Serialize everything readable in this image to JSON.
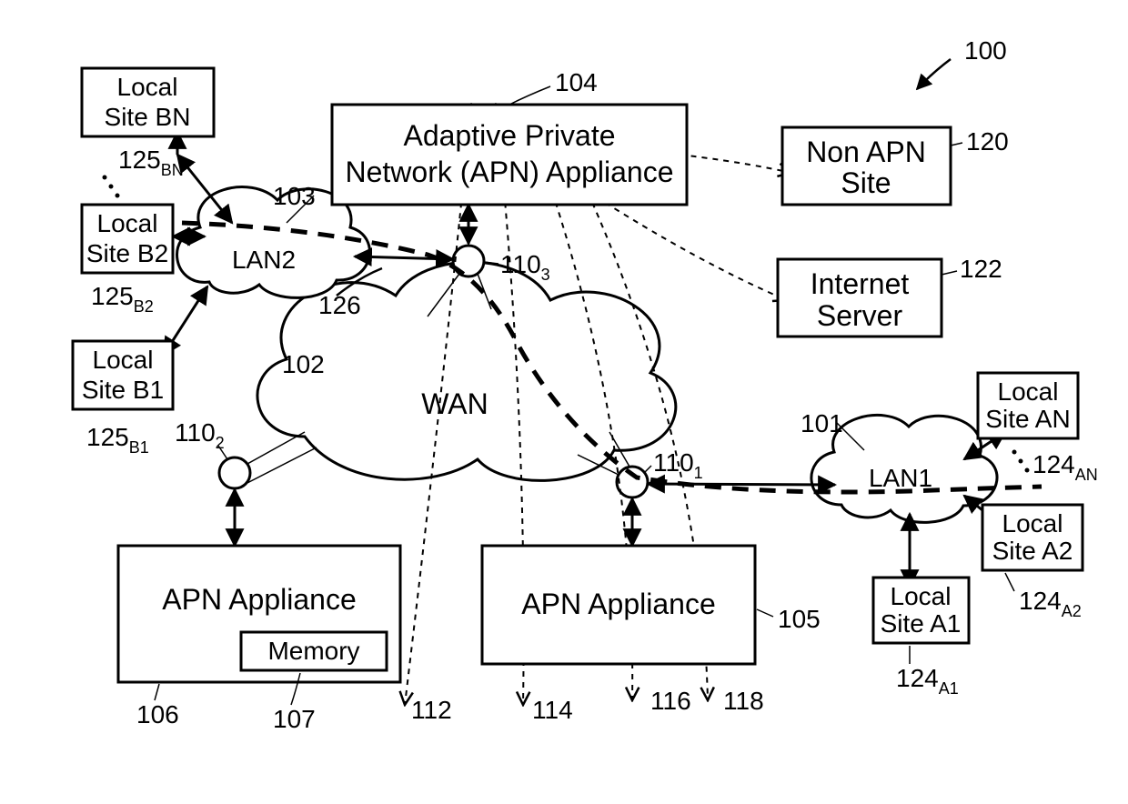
{
  "figure_ref": "100",
  "boxes": {
    "site_bn": {
      "label_l1": "Local",
      "label_l2": "Site BN",
      "ref": "125",
      "ref_sub": "BN"
    },
    "site_b2": {
      "label_l1": "Local",
      "label_l2": "Site B2",
      "ref": "125",
      "ref_sub": "B2"
    },
    "site_b1": {
      "label_l1": "Local",
      "label_l2": "Site B1",
      "ref": "125",
      "ref_sub": "B1"
    },
    "apn_main": {
      "label_l1": "Adaptive Private",
      "label_l2": "Network (APN) Appliance",
      "ref": "104"
    },
    "non_apn": {
      "label_l1": "Non APN",
      "label_l2": "Site",
      "ref": "120"
    },
    "inet": {
      "label_l1": "Internet",
      "label_l2": "Server",
      "ref": "122"
    },
    "site_an": {
      "label_l1": "Local",
      "label_l2": "Site AN",
      "ref": "124",
      "ref_sub": "AN"
    },
    "site_a2": {
      "label_l1": "Local",
      "label_l2": "Site A2",
      "ref": "124",
      "ref_sub": "A2"
    },
    "site_a1": {
      "label_l1": "Local",
      "label_l2": "Site A1",
      "ref": "124",
      "ref_sub": "A1"
    },
    "apn_left": {
      "label": "APN Appliance",
      "memory_label": "Memory",
      "ref": "106",
      "mem_ref": "107"
    },
    "apn_right": {
      "label": "APN Appliance",
      "ref": "105"
    }
  },
  "clouds": {
    "wan": {
      "label": "WAN",
      "ref": "102"
    },
    "lan1": {
      "label": "LAN1",
      "ref": "101"
    },
    "lan2": {
      "label": "LAN2",
      "ref": "103"
    }
  },
  "nodes": {
    "n1": {
      "ref": "110",
      "ref_sub": "1"
    },
    "n2": {
      "ref": "110",
      "ref_sub": "2"
    },
    "n3": {
      "ref": "110",
      "ref_sub": "3"
    }
  },
  "arrows_out": {
    "a112": "112",
    "a114": "114",
    "a116": "116",
    "a118": "118"
  },
  "path_ref": "126"
}
